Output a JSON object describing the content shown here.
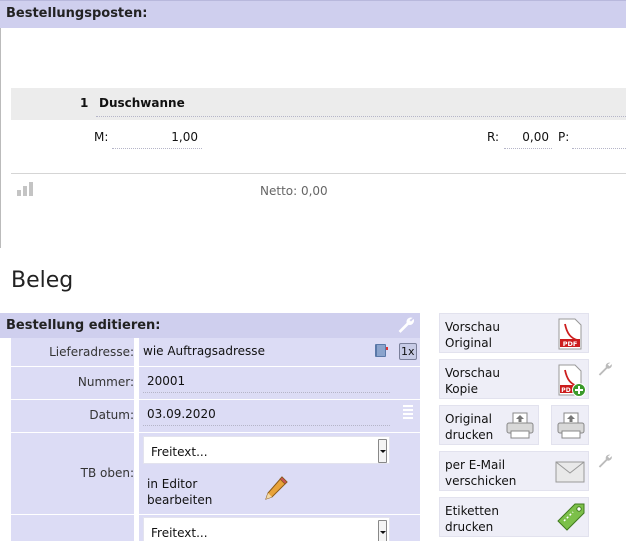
{
  "positions_panel": {
    "title": "Bestellungsposten:",
    "item": {
      "number": "1",
      "name": "Duschwanne"
    },
    "m_label": "M:",
    "m_value": "1,00",
    "r_label": "R:",
    "r_value": "0,00",
    "p_label": "P:",
    "netto": "Netto: 0,00"
  },
  "section_title": "Beleg",
  "edit_panel": {
    "title": "Bestellung editieren:",
    "fields": {
      "delivery_label": "Lieferadresse:",
      "delivery_value": "wie Auftragsadresse",
      "delivery_counter": "1x",
      "number_label": "Nummer:",
      "number_value": "20001",
      "date_label": "Datum:",
      "date_value": "03.09.2020",
      "tb_top_label": "TB oben:",
      "tb_top_select": "Freitext...",
      "tb_top_editor_line1": "in Editor",
      "tb_top_editor_line2": "bearbeiten",
      "tb_bottom_select": "Freitext..."
    }
  },
  "actions": {
    "preview_original": {
      "line1": "Vorschau",
      "line2": "Original"
    },
    "preview_copy": {
      "line1": "Vorschau",
      "line2": "Kopie"
    },
    "print_original": {
      "line1": "Original",
      "line2": "drucken"
    },
    "email": {
      "line1": "per E-Mail",
      "line2": "verschicken"
    },
    "print_labels": {
      "line1": "Etiketten",
      "line2": "drucken"
    }
  },
  "colors": {
    "header_bg": "#cfcfee",
    "form_bg": "#dcdcf5",
    "pdf_red": "#cc1d1d",
    "pencil_orange": "#e8a33a",
    "tag_green": "#7cc04a"
  },
  "icons": {
    "wrench": "wrench-icon",
    "stats": "bar-chart-icon",
    "pdf": "pdf-icon",
    "pdf_add": "pdf-add-icon",
    "printer": "printer-icon",
    "envelope": "envelope-icon",
    "tag": "tag-icon",
    "pencil": "pencil-icon",
    "book": "address-book-icon",
    "list": "list-icon"
  }
}
